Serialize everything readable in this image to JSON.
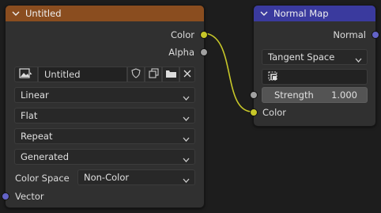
{
  "colors": {
    "image_header": "#8a4d1f",
    "normalmap_header": "#3a3a9e",
    "socket_color": "#c7c729",
    "socket_float": "#a1a1a1",
    "socket_vector": "#6363c7",
    "wire": "#c7c729"
  },
  "image_node": {
    "title": "Untitled",
    "outputs": {
      "color": "Color",
      "alpha": "Alpha"
    },
    "image_name": "Untitled",
    "icons": [
      "image-icon",
      "shield-icon",
      "duplicate-icon",
      "folder-icon",
      "close-icon"
    ],
    "interpolation": "Linear",
    "projection": "Flat",
    "extension": "Repeat",
    "source": "Generated",
    "color_space_label": "Color Space",
    "color_space_value": "Non-Color",
    "input_vector": "Vector"
  },
  "normal_node": {
    "title": "Normal Map",
    "output_normal": "Normal",
    "space": "Tangent Space",
    "uv_icon": "uv-map-icon",
    "strength_label": "Strength",
    "strength_value": "1.000",
    "input_color": "Color"
  }
}
